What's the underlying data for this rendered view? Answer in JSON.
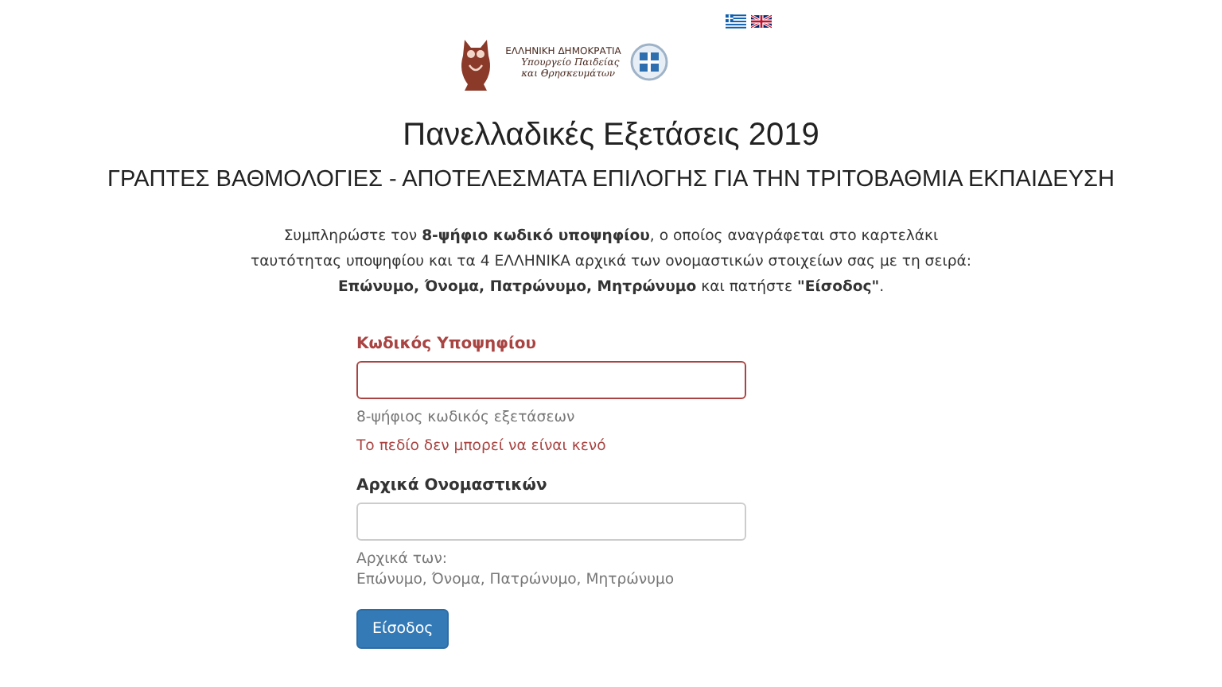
{
  "languages": [
    {
      "kind": "greek"
    },
    {
      "kind": "english"
    }
  ],
  "logo": {
    "lines": [
      "ΕΛΛΗΝΙΚΗ ΔΗΜΟΚΡΑΤΙΑ",
      "Υπουργείο Παιδείας",
      "και Θρησκευμάτων"
    ]
  },
  "title": "Πανελλαδικές Εξετάσεις 2019",
  "subtitle": "ΓΡΑΠΤΕΣ ΒΑΘΜΟΛΟΓΙΕΣ - ΑΠΟΤΕΛΕΣΜΑΤΑ ΕΠΙΛΟΓΗΣ ΓΙΑ ΤΗΝ ΤΡΙΤΟΒΑΘΜΙΑ ΕΚΠΑΙΔΕΥΣΗ",
  "instructions": [
    "Συμπληρώστε τον **8-ψήφιο κωδικό υποψηφίου**, ο οποίος αναγράφεται στο καρτελάκι",
    "ταυτότητας υποψηφίου και τα 4 ΕΛΛΗΝΙΚΑ αρχικά των ονομαστικών στοιχείων σας με τη σειρά:",
    "**Επώνυμο, Όνομα, Πατρώνυμο, Μητρώνυμο** και πατήστε **\"Είσοδος\"**."
  ],
  "fields": [
    {
      "label": "Κωδικός Υποψηφίου",
      "invalid": true,
      "help": [
        "8-ψήφιος κωδικός εξετάσεων"
      ],
      "error": "Το πεδίο δεν μπορεί να είναι κενό"
    },
    {
      "label": "Αρχικά Ονομαστικών",
      "invalid": false,
      "help": [
        "Αρχικά των:",
        "Επώνυμο, Όνομα, Πατρώνυμο, Μητρώνυμο"
      ]
    }
  ],
  "submit": "Είσοδος"
}
